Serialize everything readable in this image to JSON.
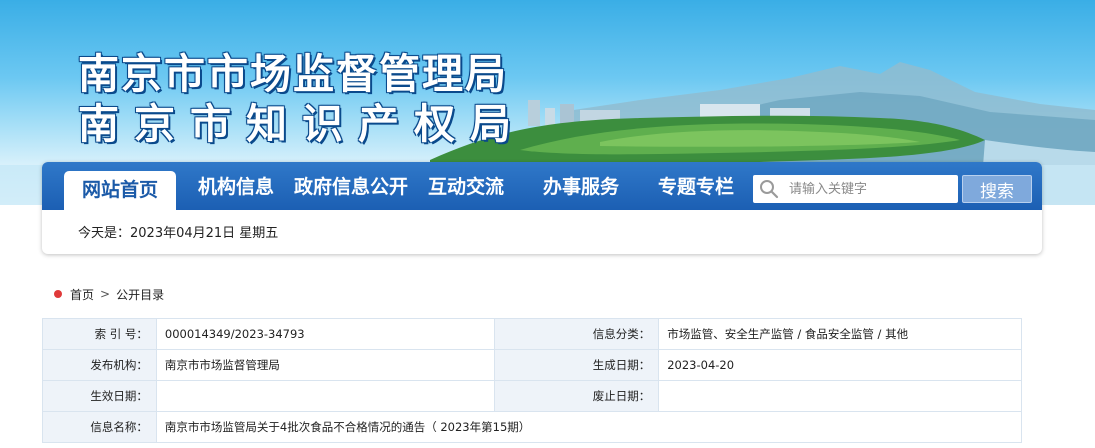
{
  "header": {
    "title_line1": "南京市市场监督管理局",
    "title_line2": "南京市知识产权局"
  },
  "nav": {
    "items": [
      {
        "label": "网站首页"
      },
      {
        "label": "机构信息"
      },
      {
        "label": "政府信息公开"
      },
      {
        "label": "互动交流"
      },
      {
        "label": "办事服务"
      },
      {
        "label": "专题专栏"
      }
    ],
    "active_index": 0,
    "search_placeholder": "请输入关键字",
    "search_button": "搜索"
  },
  "date_line": "今天是：2023年04月21日 星期五",
  "breadcrumb": {
    "home": "首页",
    "separator": ">",
    "current": "公开目录"
  },
  "meta": {
    "rows": [
      [
        {
          "label": "索 引 号：",
          "value": "000014349/2023-34793"
        },
        {
          "label": "信息分类：",
          "value": "市场监管、安全生产监管 / 食品安全监管 / 其他"
        }
      ],
      [
        {
          "label": "发布机构：",
          "value": "南京市市场监督管理局"
        },
        {
          "label": "生成日期：",
          "value": "2023-04-20"
        }
      ],
      [
        {
          "label": "生效日期：",
          "value": ""
        },
        {
          "label": "废止日期：",
          "value": ""
        }
      ]
    ],
    "name_label": "信息名称：",
    "name_value": "南京市市场监管局关于4批次食品不合格情况的通告（ 2023年第15期）"
  },
  "colors": {
    "nav_blue": "#1c5fb3",
    "active_text": "#1b5aa8",
    "label_bg": "#eef3f9",
    "home_dot": "#e03a3a"
  }
}
